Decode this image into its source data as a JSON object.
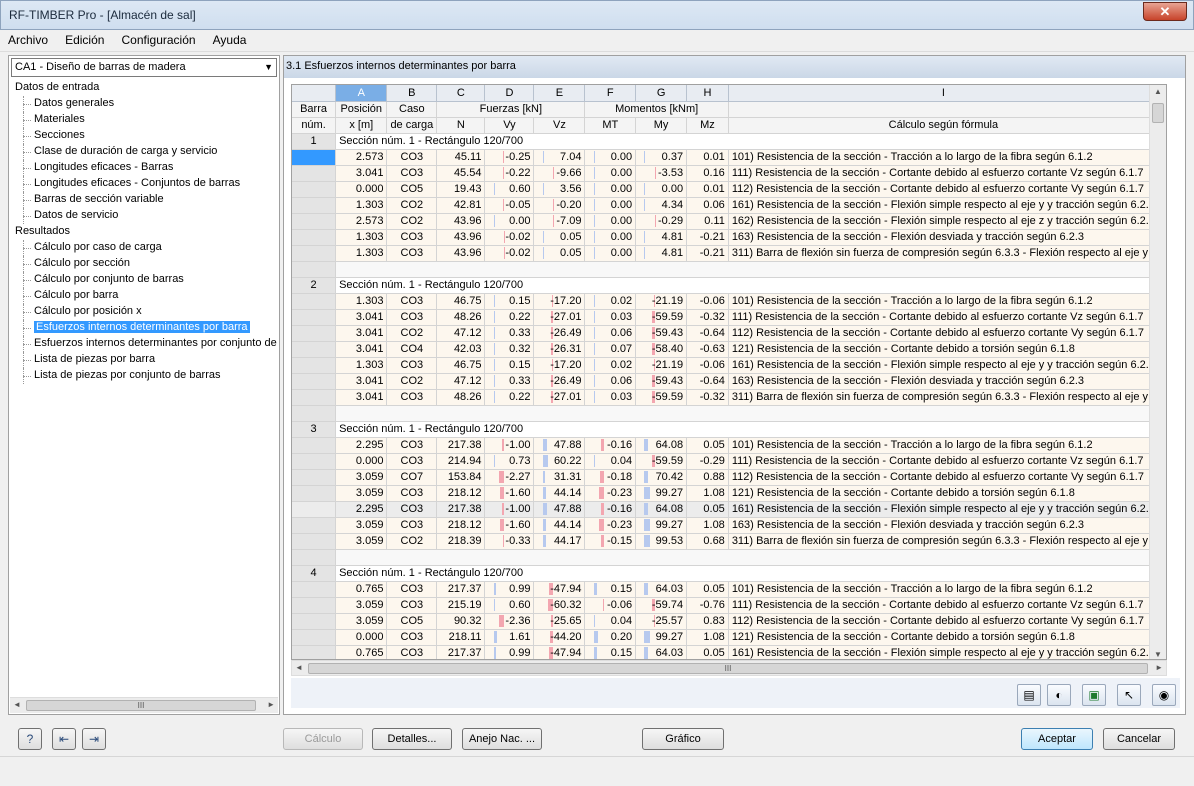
{
  "window": {
    "title": "RF-TIMBER Pro - [Almacén de sal]",
    "close": "✕"
  },
  "menu": [
    "Archivo",
    "Edición",
    "Configuración",
    "Ayuda"
  ],
  "case_select": "CA1 - Diseño de barras de madera",
  "tree": [
    {
      "label": "Datos de entrada",
      "level": 1
    },
    {
      "label": "Datos generales",
      "level": 2
    },
    {
      "label": "Materiales",
      "level": 2
    },
    {
      "label": "Secciones",
      "level": 2
    },
    {
      "label": "Clase de duración de carga y servicio",
      "level": 2
    },
    {
      "label": "Longitudes eficaces - Barras",
      "level": 2
    },
    {
      "label": "Longitudes eficaces - Conjuntos de barras",
      "level": 2
    },
    {
      "label": "Barras de sección variable",
      "level": 2
    },
    {
      "label": "Datos de servicio",
      "level": 2
    },
    {
      "label": "Resultados",
      "level": 1
    },
    {
      "label": "Cálculo por caso de carga",
      "level": 2
    },
    {
      "label": "Cálculo por sección",
      "level": 2
    },
    {
      "label": "Cálculo por conjunto de barras",
      "level": 2
    },
    {
      "label": "Cálculo por barra",
      "level": 2
    },
    {
      "label": "Cálculo por posición x",
      "level": 2
    },
    {
      "label": "Esfuerzos internos determinantes por barra",
      "level": 2,
      "selected": true
    },
    {
      "label": "Esfuerzos internos determinantes por conjunto de",
      "level": 2
    },
    {
      "label": "Lista de piezas por barra",
      "level": 2
    },
    {
      "label": "Lista de piezas por conjunto de barras",
      "level": 2
    }
  ],
  "panel_title": "3.1  Esfuerzos internos determinantes por barra",
  "columns": [
    "A",
    "B",
    "C",
    "D",
    "E",
    "F",
    "G",
    "H",
    "I"
  ],
  "headers": {
    "barra": "Barra",
    "num": "núm.",
    "posicion": "Posición",
    "x": "x [m]",
    "caso": "Caso",
    "decarga": "de carga",
    "fuerzas": "Fuerzas [kN]",
    "momentos": "Momentos [kNm]",
    "N": "N",
    "Vy": "Vy",
    "Vz": "Vz",
    "MT": "MT",
    "My": "My",
    "Mz": "Mz",
    "calculo": "Cálculo según fórmula"
  },
  "groups": [
    {
      "member": "1",
      "section": "Sección núm. 1 - Rectángulo 120/700",
      "rows": [
        [
          "2.573",
          "CO3",
          "45.11",
          "-0.25",
          "7.04",
          "0.00",
          "0.37",
          "0.01",
          "101) Resistencia de la sección - Tracción a lo largo de la fibra según 6.1.2"
        ],
        [
          "3.041",
          "CO3",
          "45.54",
          "-0.22",
          "-9.66",
          "0.00",
          "-3.53",
          "0.16",
          "111) Resistencia de la sección - Cortante debido al esfuerzo cortante Vz según 6.1.7"
        ],
        [
          "0.000",
          "CO5",
          "19.43",
          "0.60",
          "3.56",
          "0.00",
          "0.00",
          "0.01",
          "112) Resistencia de la sección - Cortante debido al esfuerzo cortante Vy según 6.1.7"
        ],
        [
          "1.303",
          "CO2",
          "42.81",
          "-0.05",
          "-0.20",
          "0.00",
          "4.34",
          "0.06",
          "161) Resistencia de la sección - Flexión simple respecto al eje y y tracción según 6.2.3"
        ],
        [
          "2.573",
          "CO2",
          "43.96",
          "0.00",
          "-7.09",
          "0.00",
          "-0.29",
          "0.11",
          "162) Resistencia de la sección - Flexión simple respecto al eje z y tracción según 6.2.3"
        ],
        [
          "1.303",
          "CO3",
          "43.96",
          "-0.02",
          "0.05",
          "0.00",
          "4.81",
          "-0.21",
          "163) Resistencia de la sección - Flexión desviada y tracción según 6.2.3"
        ],
        [
          "1.303",
          "CO3",
          "43.96",
          "-0.02",
          "0.05",
          "0.00",
          "4.81",
          "-0.21",
          "311) Barra de flexión sin fuerza de compresión según 6.3.3 - Flexión respecto al eje y"
        ]
      ]
    },
    {
      "member": "2",
      "section": "Sección núm. 1 - Rectángulo 120/700",
      "rows": [
        [
          "1.303",
          "CO3",
          "46.75",
          "0.15",
          "-17.20",
          "0.02",
          "-21.19",
          "-0.06",
          "101) Resistencia de la sección - Tracción a lo largo de la fibra según 6.1.2"
        ],
        [
          "3.041",
          "CO3",
          "48.26",
          "0.22",
          "-27.01",
          "0.03",
          "-59.59",
          "-0.32",
          "111) Resistencia de la sección - Cortante debido al esfuerzo cortante Vz según 6.1.7"
        ],
        [
          "3.041",
          "CO2",
          "47.12",
          "0.33",
          "-26.49",
          "0.06",
          "-59.43",
          "-0.64",
          "112) Resistencia de la sección - Cortante debido al esfuerzo cortante Vy según 6.1.7"
        ],
        [
          "3.041",
          "CO4",
          "42.03",
          "0.32",
          "-26.31",
          "0.07",
          "-58.40",
          "-0.63",
          "121) Resistencia de la sección - Cortante debido a torsión según 6.1.8"
        ],
        [
          "1.303",
          "CO3",
          "46.75",
          "0.15",
          "-17.20",
          "0.02",
          "-21.19",
          "-0.06",
          "161) Resistencia de la sección - Flexión simple respecto al eje y y tracción según 6.2.3"
        ],
        [
          "3.041",
          "CO2",
          "47.12",
          "0.33",
          "-26.49",
          "0.06",
          "-59.43",
          "-0.64",
          "163) Resistencia de la sección - Flexión desviada y tracción según 6.2.3"
        ],
        [
          "3.041",
          "CO3",
          "48.26",
          "0.22",
          "-27.01",
          "0.03",
          "-59.59",
          "-0.32",
          "311) Barra de flexión sin fuerza de compresión según 6.3.3 - Flexión respecto al eje y"
        ]
      ]
    },
    {
      "member": "3",
      "section": "Sección núm. 1 - Rectángulo 120/700",
      "rows": [
        [
          "2.295",
          "CO3",
          "217.38",
          "-1.00",
          "47.88",
          "-0.16",
          "64.08",
          "0.05",
          "101) Resistencia de la sección - Tracción a lo largo de la fibra según 6.1.2"
        ],
        [
          "0.000",
          "CO3",
          "214.94",
          "0.73",
          "60.22",
          "0.04",
          "-59.59",
          "-0.29",
          "111) Resistencia de la sección - Cortante debido al esfuerzo cortante Vz según 6.1.7"
        ],
        [
          "3.059",
          "CO7",
          "153.84",
          "-2.27",
          "31.31",
          "-0.18",
          "70.42",
          "0.88",
          "112) Resistencia de la sección - Cortante debido al esfuerzo cortante Vy según 6.1.7"
        ],
        [
          "3.059",
          "CO3",
          "218.12",
          "-1.60",
          "44.14",
          "-0.23",
          "99.27",
          "1.08",
          "121) Resistencia de la sección - Cortante debido a torsión según 6.1.8"
        ],
        [
          "2.295",
          "CO3",
          "217.38",
          "-1.00",
          "47.88",
          "-0.16",
          "64.08",
          "0.05",
          "161) Resistencia de la sección - Flexión simple respecto al eje y y tracción según 6.2.3"
        ],
        [
          "3.059",
          "CO3",
          "218.12",
          "-1.60",
          "44.14",
          "-0.23",
          "99.27",
          "1.08",
          "163) Resistencia de la sección - Flexión desviada y tracción según 6.2.3"
        ],
        [
          "3.059",
          "CO2",
          "218.39",
          "-0.33",
          "44.17",
          "-0.15",
          "99.53",
          "0.68",
          "311) Barra de flexión sin fuerza de compresión según 6.3.3 - Flexión respecto al eje y"
        ]
      ]
    },
    {
      "member": "4",
      "section": "Sección núm. 1 - Rectángulo 120/700",
      "rows": [
        [
          "0.765",
          "CO3",
          "217.37",
          "0.99",
          "-47.94",
          "0.15",
          "64.03",
          "0.05",
          "101) Resistencia de la sección - Tracción a lo largo de la fibra según 6.1.2"
        ],
        [
          "3.059",
          "CO3",
          "215.19",
          "0.60",
          "-60.32",
          "-0.06",
          "-59.74",
          "-0.76",
          "111) Resistencia de la sección - Cortante debido al esfuerzo cortante Vz según 6.1.7"
        ],
        [
          "3.059",
          "CO5",
          "90.32",
          "-2.36",
          "-25.65",
          "0.04",
          "-25.57",
          "0.83",
          "112) Resistencia de la sección - Cortante debido al esfuerzo cortante Vy según 6.1.7"
        ],
        [
          "0.000",
          "CO3",
          "218.11",
          "1.61",
          "-44.20",
          "0.20",
          "99.27",
          "1.08",
          "121) Resistencia de la sección - Cortante debido a torsión según 6.1.8"
        ],
        [
          "0.765",
          "CO3",
          "217.37",
          "0.99",
          "-47.94",
          "0.15",
          "64.03",
          "0.05",
          "161) Resistencia de la sección - Flexión simple respecto al eje y y tracción según 6.2.3"
        ]
      ]
    }
  ],
  "scroll_grip": "III",
  "toolbar_icons": [
    "table-view-icon",
    "color-scale-icon",
    "excel-export-icon",
    "select-member-icon",
    "view-icon"
  ],
  "buttons": {
    "calculo": "Cálculo",
    "detalles": "Detalles...",
    "anejo": "Anejo Nac. ...",
    "grafico": "Gráfico",
    "aceptar": "Aceptar",
    "cancelar": "Cancelar"
  },
  "bar_colors": {
    "negative": "#f3a6b0",
    "positive": "#b7c9ee"
  }
}
